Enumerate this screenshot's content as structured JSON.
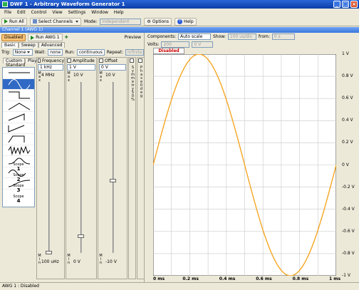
{
  "window": {
    "title": "DWF 1 - Arbitrary Waveform Generator 1"
  },
  "menu": [
    "File",
    "Edit",
    "Control",
    "View",
    "Settings",
    "Window",
    "Help"
  ],
  "toolbar": {
    "run_all": "Run All",
    "select_channels": "Select Channels",
    "mode_label": "Mode:",
    "mode_value": "Independent",
    "options": "Options",
    "help": "Help"
  },
  "channel_tab": "Channel 1 (AWG 1)",
  "left": {
    "disabled": "Disabled",
    "run_awg": "Run AWG 1",
    "preview": "Preview",
    "tabs": [
      "Basic",
      "Sweep",
      "Advanced"
    ],
    "trig_label": "Trig:",
    "trig_value": "None",
    "wait_label": "Wait:",
    "wait_value": "none",
    "run_label": "Run:",
    "run_value": "continuous",
    "repeat_label": "Repeat:",
    "repeat_value": "infinite",
    "subtabs": [
      "Custom",
      "Player"
    ],
    "standard": "Standard",
    "scopes": [
      {
        "l": "Scope",
        "n": "1"
      },
      {
        "l": "Scope",
        "n": "2"
      },
      {
        "l": "Scope",
        "n": "3"
      },
      {
        "l": "Scope",
        "n": "4"
      }
    ],
    "frequency": {
      "label": "Frequency",
      "value": "1 kHz",
      "max": "4 MHz",
      "min": "100 uHz"
    },
    "amplitude": {
      "label": "Amplitude",
      "value": "1 V",
      "max": "10 V",
      "min": "0 V"
    },
    "offset": {
      "label": "Offset",
      "value": "0 V",
      "max": "10 V",
      "min": "-10 V"
    },
    "symmetry": "Symmetry 50 %",
    "phase": "Phase 0 deg"
  },
  "right": {
    "components_label": "Components:",
    "components_value": "Auto scale",
    "show_label": "Show:",
    "show_value": "100 us/div",
    "from_label": "from:",
    "from_value": "0 s",
    "volts_label": "Volts:",
    "volts_value": "200 mV/div",
    "volts_offset": "0 V",
    "chart_status": "Disabled"
  },
  "status": "AWG 1 : Disabled",
  "chart_data": {
    "type": "line",
    "title": "",
    "xlabel": "",
    "ylabel": "",
    "x_ticks": [
      "0 ms",
      "0.2 ms",
      "0.4 ms",
      "0.6 ms",
      "0.8 ms",
      "1 ms"
    ],
    "y_ticks": [
      "1 V",
      "0.8 V",
      "0.6 V",
      "0.4 V",
      "0.2 V",
      "0 V",
      "-0.2 V",
      "-0.4 V",
      "-0.6 V",
      "-0.8 V",
      "-1 V"
    ],
    "xlim": [
      0,
      1
    ],
    "ylim": [
      -1,
      1
    ],
    "series": [
      {
        "function": "sine",
        "amplitude": 1,
        "frequency_khz": 1,
        "color": "#f5a623"
      }
    ],
    "grid": true
  }
}
